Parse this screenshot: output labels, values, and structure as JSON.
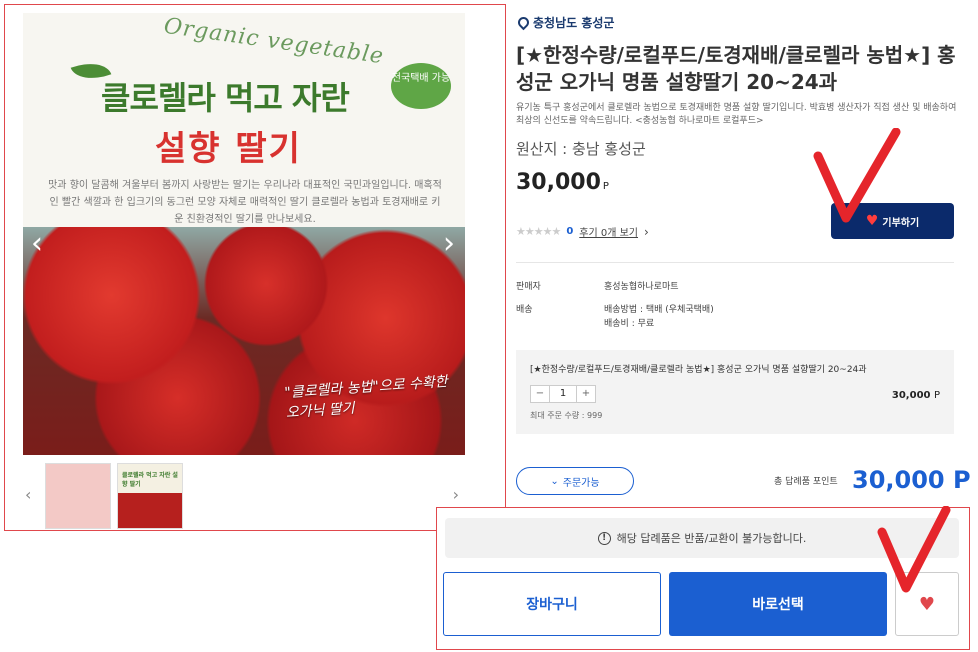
{
  "gallery": {
    "subtitle_script": "Organic vegetable",
    "title_line1": "클로렐라 먹고 자란",
    "title_line2": "설향 딸기",
    "badge": "전국택배 가능",
    "description": "맛과 향이 달콤해 겨울부터 봄까지 사랑받는 딸기는 우리나라 대표적인 국민과일입니다. 매혹적인 빨간 색깔과 한 입크기의 동그런 모양 자체로 매력적인 딸기 클로렐라 농법과 토경재배로 키운 친환경적인 딸기를 만나보세요.",
    "photo_caption": "\"클로렐라 농법\"으로 수확한 오가닉 딸기",
    "prev_arrow": "‹",
    "next_arrow": "›",
    "thumb_prev": "‹",
    "thumb_next": "›",
    "thumb2_text": "클로렐라 먹고 자란 설향 딸기"
  },
  "product": {
    "region": "충청남도 홍성군",
    "title": "[★한정수량/로컬푸드/토경재배/클로렐라 농법★] 홍성군 오가닉 명품 설향딸기 20~24과",
    "description": "유기농 특구 홍성군에서 클로렐라 농법으로 토경재배한 명품 설향 딸기입니다. 박효병 생산자가 직접 생산 및 배송하여 최상의 신선도를 약속드립니다. <충성농협 하나로마트 로컬푸드>",
    "origin": "원산지 : 충남 홍성군",
    "price": "30,000",
    "price_unit": "P",
    "stars": "★★★★★",
    "review_count": "0",
    "review_link": "후기 0개 보기",
    "review_arrow": "›",
    "donate_label": "기부하기"
  },
  "info": {
    "seller_label": "판매자",
    "seller_value": "홍성농협하나로마트",
    "delivery_label": "배송",
    "delivery_method": "배송방법 : 택배 (우체국택배)",
    "delivery_fee": "배송비 : 무료"
  },
  "option": {
    "name": "[★한정수량/로컬푸드/토경재배/클로렐라 농법★] 홍성군 오가닉 명품 설향딸기 20~24과",
    "minus": "−",
    "qty": "1",
    "plus": "+",
    "price": "30,000",
    "price_unit": "P",
    "max_order": "최대 주문 수량 : 999"
  },
  "order": {
    "status_label": "주문가능",
    "total_label": "총 답례품 포인트",
    "total_value": "30,000 P"
  },
  "bottom": {
    "notice": "해당 답례품은 반품/교환이 불가능합니다.",
    "cart_label": "장바구니",
    "buy_label": "바로선택"
  },
  "colors": {
    "accent_blue": "#1b5fd1",
    "navy": "#0b2a6b",
    "highlight_red": "#e0474c"
  }
}
